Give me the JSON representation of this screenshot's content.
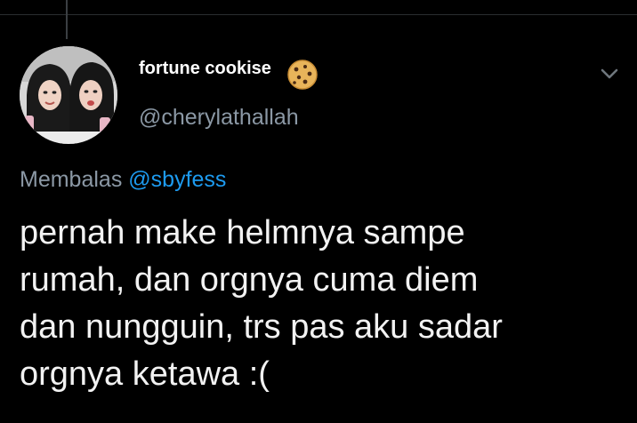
{
  "tweet": {
    "display_name": "fortune cookise",
    "name_emoji": "cookie-icon",
    "handle": "@cherylathallah",
    "reply_prefix": "Membalas",
    "reply_mention": "@sbyfess",
    "text_lines": [
      "pernah make helmnya sampe",
      "rumah, dan orgnya cuma diem",
      "dan nungguin, trs pas aku sadar",
      "orgnya ketawa :("
    ],
    "more_icon": "chevron-down-icon",
    "avatar": "profile-photo"
  },
  "colors": {
    "background": "#000000",
    "text_primary": "#f2f2f2",
    "text_secondary": "#8b98a5",
    "link": "#1d9bf0"
  }
}
